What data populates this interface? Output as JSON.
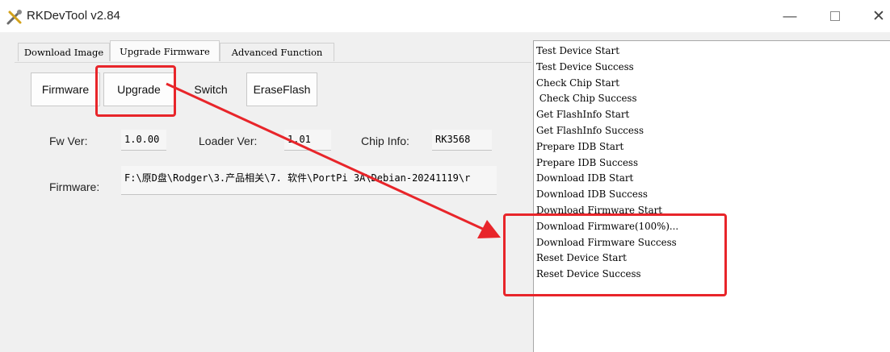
{
  "window": {
    "title": "RKDevTool v2.84",
    "icon": "tools-icon"
  },
  "window_controls": {
    "minimize": "—",
    "close": "✕"
  },
  "tabs": [
    {
      "label": "Download Image"
    },
    {
      "label": "Upgrade Firmware"
    },
    {
      "label": "Advanced Function"
    }
  ],
  "actions": {
    "firmware": "Firmware",
    "upgrade": "Upgrade",
    "switch": "Switch",
    "erase_flash": "EraseFlash"
  },
  "info": {
    "fw_ver_label": "Fw Ver:",
    "fw_ver": "1.0.00",
    "loader_ver_label": "Loader Ver:",
    "loader_ver": "1.01",
    "chip_info_label": "Chip Info:",
    "chip_info": "RK3568",
    "firmware_label": "Firmware:",
    "firmware_path": "F:\\原D盘\\Rodger\\3.产品相关\\7. 软件\\PortPi 3A\\Debian-20241119\\r"
  },
  "log": [
    "Test Device Start",
    "Test Device Success",
    "Check Chip Start",
    " Check Chip Success",
    "Get FlashInfo Start",
    "Get FlashInfo Success",
    "Prepare IDB Start",
    "Prepare IDB Success",
    "Download IDB Start",
    "Download IDB Success",
    "Download Firmware Start",
    "Download Firmware(100%)...",
    "Download Firmware Success",
    "Reset Device Start",
    "Reset Device Success"
  ],
  "annotation_color": "#e8252a"
}
